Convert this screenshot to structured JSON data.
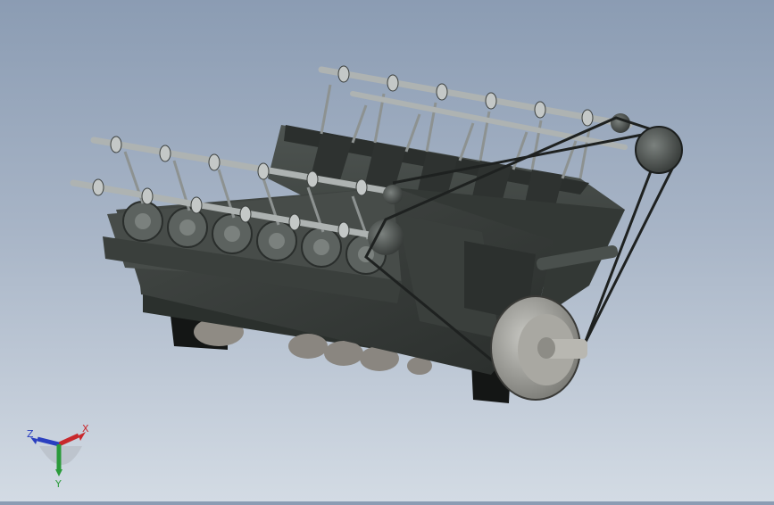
{
  "viewport": {
    "background_top": "#8b9cb3",
    "background_bottom": "#d3dbe4",
    "model_color": "#3d423f",
    "model_dark": "#252927",
    "model_light": "#6a706c",
    "pulley_color": "#8e8e8a",
    "valvetrain_color": "#9fa3a2"
  },
  "triad": {
    "x_label": "X",
    "y_label": "Y",
    "z_label": "Z",
    "x_color": "#c8282c",
    "y_color": "#2a9a3a",
    "z_color": "#2a3fc0"
  }
}
